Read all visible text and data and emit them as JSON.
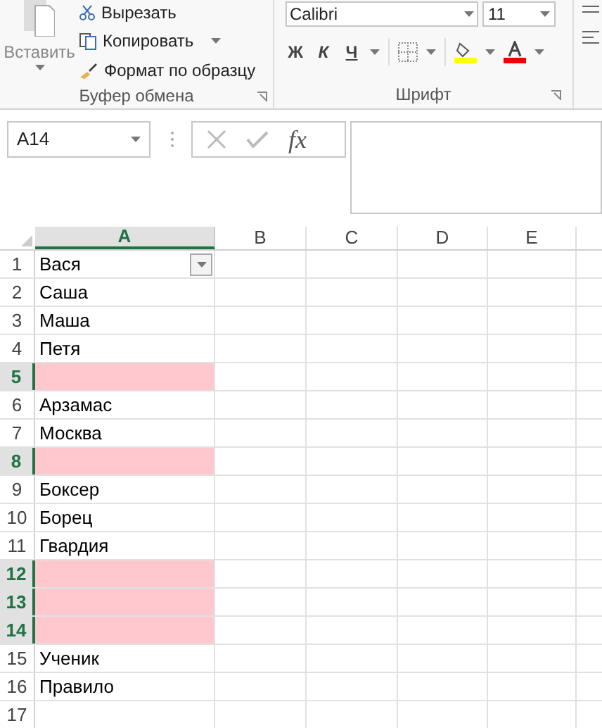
{
  "ribbon": {
    "clipboard": {
      "paste": "Вставить",
      "cut": "Вырезать",
      "copy": "Копировать",
      "format_painter": "Формат по образцу",
      "label": "Буфер обмена"
    },
    "font": {
      "font_name": "Calibri",
      "font_size": "11",
      "bold": "Ж",
      "italic": "К",
      "underline": "Ч",
      "label": "Шрифт"
    }
  },
  "formula_bar": {
    "name_box": "A14",
    "fx": "fx"
  },
  "columns": [
    {
      "label": "A",
      "selected": true
    },
    {
      "label": "B",
      "selected": false
    },
    {
      "label": "C",
      "selected": false
    },
    {
      "label": "D",
      "selected": false
    },
    {
      "label": "E",
      "selected": false
    }
  ],
  "rows": [
    {
      "number": "1",
      "value": "Вася",
      "selected": false,
      "filter": true
    },
    {
      "number": "2",
      "value": "Саша",
      "selected": false
    },
    {
      "number": "3",
      "value": "Маша",
      "selected": false
    },
    {
      "number": "4",
      "value": "Петя",
      "selected": false
    },
    {
      "number": "5",
      "selected": true,
      "color": "#ffc7ce"
    },
    {
      "number": "6",
      "value": "Арзамас",
      "selected": false
    },
    {
      "number": "7",
      "value": "Москва",
      "selected": false
    },
    {
      "number": "8",
      "selected": true,
      "color": "#ffc7ce"
    },
    {
      "number": "9",
      "value": "Боксер",
      "selected": false
    },
    {
      "number": "10",
      "value": "Борец",
      "selected": false
    },
    {
      "number": "11",
      "value": "Гвардия",
      "selected": false
    },
    {
      "number": "12",
      "selected": true,
      "color": "#ffc7ce"
    },
    {
      "number": "13",
      "selected": true,
      "color": "#ffc7ce"
    },
    {
      "number": "14",
      "selected": true,
      "color": "#ffc7ce"
    },
    {
      "number": "15",
      "value": "Ученик",
      "selected": false
    },
    {
      "number": "16",
      "value": "Правило",
      "selected": false
    },
    {
      "number": "17",
      "selected": false
    }
  ]
}
